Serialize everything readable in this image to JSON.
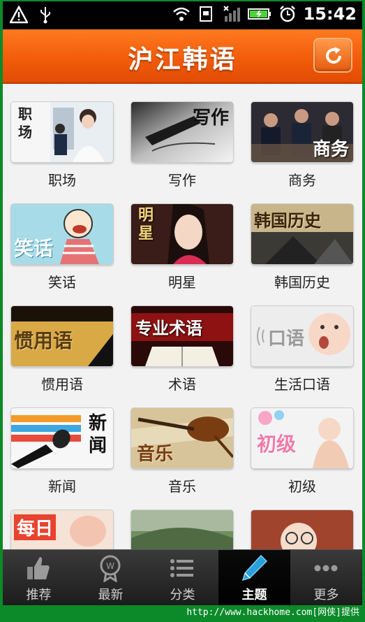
{
  "status_bar": {
    "time": "15:42"
  },
  "header": {
    "title": "沪江韩语"
  },
  "grid": {
    "items": [
      {
        "label": "职场",
        "caption": "职场"
      },
      {
        "label": "写作",
        "caption": "写作"
      },
      {
        "label": "商务",
        "caption": "商务"
      },
      {
        "label": "笑话",
        "caption": "笑话"
      },
      {
        "label": "明星",
        "caption": "明星"
      },
      {
        "label": "韩国历史",
        "caption": "韩国历史"
      },
      {
        "label": "惯用语",
        "caption": "惯用语"
      },
      {
        "label": "术语",
        "caption": "专业术语"
      },
      {
        "label": "生活口语",
        "caption": "口语"
      },
      {
        "label": "新闻",
        "caption": "新闻"
      },
      {
        "label": "音乐",
        "caption": "音乐"
      },
      {
        "label": "初级",
        "caption": "初级"
      },
      {
        "label": "",
        "caption": "每日"
      },
      {
        "label": "",
        "caption": ""
      },
      {
        "label": "",
        "caption": ""
      }
    ]
  },
  "bottom_nav": {
    "items": [
      {
        "label": "推荐",
        "icon": "thumbs-up-icon"
      },
      {
        "label": "最新",
        "icon": "badge-icon"
      },
      {
        "label": "分类",
        "icon": "list-icon"
      },
      {
        "label": "主题",
        "icon": "pen-icon"
      },
      {
        "label": "更多",
        "icon": "more-icon"
      }
    ],
    "active_index": 3
  },
  "footer": {
    "watermark": "http://www.hackhome.com[网侠]提供"
  }
}
